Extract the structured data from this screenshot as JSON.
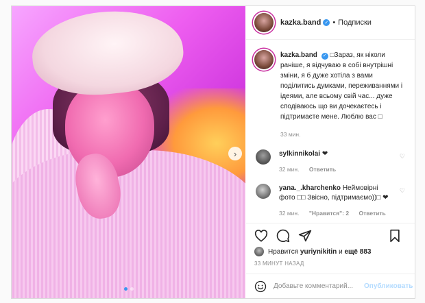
{
  "post": {
    "username": "kazka.band",
    "separator": "•",
    "follow_label": "Подписки",
    "caption_user": "kazka.band",
    "caption_text": "□Зараз, як ніколи раніше, я відчуваю в собі внутрішні зміни, я б дуже хотіла з вами поділитись думками, переживаннями і ідеями, але всьому свій час... дуже сподіваюсь що ви дочекаєтесь і підтримаєте мене. Люблю вас □",
    "caption_time": "33 мин.",
    "comments": [
      {
        "user": "sylkinnikolai",
        "text": "❤",
        "time": "32 мин.",
        "reply": "Ответить"
      },
      {
        "user": "yana._.kharchenko",
        "text": "Неймовірні фото □□ Звісно, підтримаємо))□ ❤",
        "time": "32 мин.",
        "note": "\"Нравится\": 2",
        "reply": "Ответить"
      }
    ],
    "likes_prefix": "Нравится",
    "likes_user": "yuriynikitin",
    "likes_conj": "и",
    "likes_more": "ещё 883",
    "posted_ago": "33 МИНУТ НАЗАД",
    "comment_placeholder": "Добавьте комментарий...",
    "publish_label": "Опубликовать",
    "carousel": {
      "total": 2,
      "current": 1
    },
    "icons": {
      "next": "chevron-right-icon",
      "like": "heart-icon",
      "comment": "comment-icon",
      "share": "paper-plane-icon",
      "save": "bookmark-icon",
      "emoji": "smiley-icon",
      "verified": "verified-badge-icon"
    },
    "colors": {
      "accent": "#3897f0",
      "publish_disabled": "#b3dbff"
    }
  }
}
